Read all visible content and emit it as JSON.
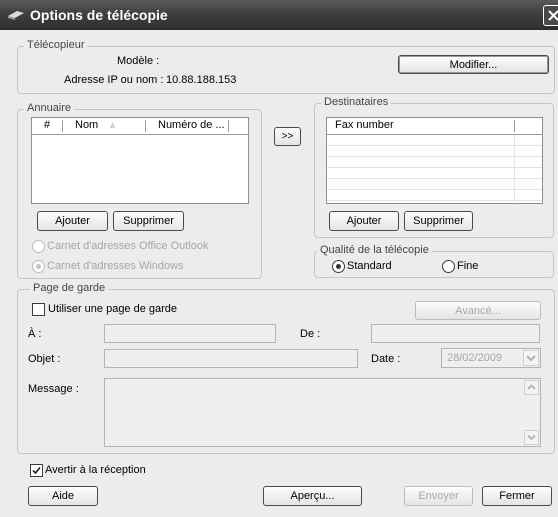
{
  "window": {
    "title": "Options de télécopie"
  },
  "telecopieur": {
    "legend": "Télécopieur",
    "modele_label": "Modèle :",
    "modele_value": "",
    "ip_label": "Adresse IP ou nom :",
    "ip_value": "10.88.188.153",
    "modifier_button": "Modifier..."
  },
  "annuaire": {
    "legend": "Annuaire",
    "columns": [
      "#",
      "Nom",
      "Numéro de ..."
    ],
    "sort_glyph": "⩓",
    "add_button": "Ajouter",
    "delete_button": "Supprimer",
    "options": [
      {
        "label": "Carnet d'adresses Office Outlook",
        "selected": false
      },
      {
        "label": "Carnet d'adresses Windows",
        "selected": true
      }
    ]
  },
  "transfer_button": ">>",
  "destinataires": {
    "legend": "Destinataires",
    "columns": [
      "Fax number"
    ],
    "add_button": "Ajouter",
    "delete_button": "Supprimer"
  },
  "qualite": {
    "legend": "Qualité de la télécopie",
    "options": [
      {
        "label": "Standard",
        "selected": true
      },
      {
        "label": "Fine",
        "selected": false
      }
    ]
  },
  "page_de_garde": {
    "legend": "Page de garde",
    "use_label": "Utiliser une page de garde",
    "use_checked": false,
    "advanced_button": "Avancé...",
    "a_label": "À :",
    "a_value": "",
    "de_label": "De :",
    "de_value": "",
    "objet_label": "Objet :",
    "objet_value": "",
    "date_label": "Date :",
    "date_value": "28/02/2009",
    "message_label": "Message :",
    "message_value": ""
  },
  "notify": {
    "label": "Avertir à la réception",
    "checked": true
  },
  "footer": {
    "aide": "Aide",
    "apercu": "Aperçu...",
    "envoyer": "Envoyer",
    "fermer": "Fermer"
  },
  "colors": {
    "titlebar": "#3f3f3f",
    "dialog_bg": "#ececec",
    "disabled_text": "#a6a6a6"
  }
}
